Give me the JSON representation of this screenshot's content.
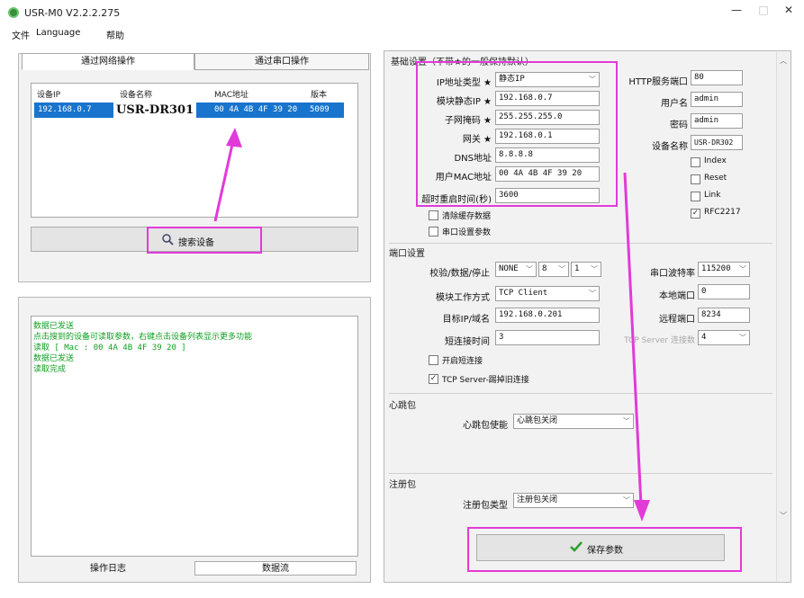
{
  "window": {
    "title": "USR-M0 V2.2.2.275",
    "min": "—",
    "max": "□",
    "close": "✕"
  },
  "menu": [
    "文件",
    "Language",
    "帮助"
  ],
  "left": {
    "tabs": [
      "通过网络操作",
      "通过串口操作"
    ],
    "columns": [
      "设备IP",
      "设备名称",
      "MAC地址",
      "版本"
    ],
    "row": {
      "ip": "192.168.0.7",
      "name": "USR-DR301",
      "mac": "00 4A 4B 4F 39 20",
      "version": "5009"
    },
    "search_button": "搜索设备",
    "log": [
      "数据已发送",
      "点击搜到的设备可读取参数，右键点击设备列表显示更多功能",
      "读取 [ Mac : 00 4A 4B 4F 39 20 ]",
      "数据已发送",
      "读取完成"
    ],
    "bottom_tabs": [
      "操作日志",
      "数据流"
    ]
  },
  "basic": {
    "section_title": "基础设置（不带★的一般保持默认）",
    "ip_type_label": "IP地址类型 ★",
    "ip_type_value": "静态IP",
    "static_ip_label": "模块静态IP ★",
    "static_ip_value": "192.168.0.7",
    "mask_label": "子网掩码 ★",
    "mask_value": "255.255.255.0",
    "gateway_label": "网关 ★",
    "gateway_value": "192.168.0.1",
    "dns_label": "DNS地址",
    "dns_value": "8.8.8.8",
    "mac_label": "用户MAC地址",
    "mac_value": "00 4A 4B 4F 39 20",
    "reboot_label": "超时重启时间(秒)",
    "reboot_value": "3600",
    "clear_cache": "清除缓存数据",
    "serial_params": "串口设置参数",
    "http_port_label": "HTTP服务端口",
    "http_port_value": "80",
    "user_label": "用户名",
    "user_value": "admin",
    "pwd_label": "密码",
    "pwd_value": "admin",
    "devname_label": "设备名称",
    "devname_value": "USR-DR302",
    "cb_index": "Index",
    "cb_reset": "Reset",
    "cb_link": "Link",
    "cb_rfc": "RFC2217",
    "rfc_check": "✓"
  },
  "port": {
    "section_title": "端口设置",
    "parity_label": "校验/数据/停止",
    "parity_value": "NONE",
    "data_value": "8",
    "stop_value": "1",
    "baud_label": "串口波特率",
    "baud_value": "115200",
    "mode_label": "模块工作方式",
    "mode_value": "TCP Client",
    "local_port_label": "本地端口",
    "local_port_value": "0",
    "target_label": "目标IP/域名",
    "target_value": "192.168.0.201",
    "remote_port_label": "远程端口",
    "remote_port_value": "8234",
    "reconnect_label": "短连接时间",
    "reconnect_value": "3",
    "tcp_server_label": "TCP Server 连接数",
    "tcp_server_value": "4",
    "enable_short": "开启短连接",
    "kick_old": "TCP Server-踢掉旧连接",
    "kick_check": "✓"
  },
  "heartbeat": {
    "section_title": "心跳包",
    "label": "心跳包使能",
    "value": "心跳包关闭"
  },
  "register": {
    "section_title": "注册包",
    "label": "注册包类型",
    "value": "注册包关闭"
  },
  "save_button": "保存参数",
  "icons": {
    "search": "search-icon",
    "check": "check-icon"
  },
  "colors": {
    "highlight": "#e23ad9",
    "selection": "#1874cd",
    "log_text": "#0f9f1f"
  }
}
